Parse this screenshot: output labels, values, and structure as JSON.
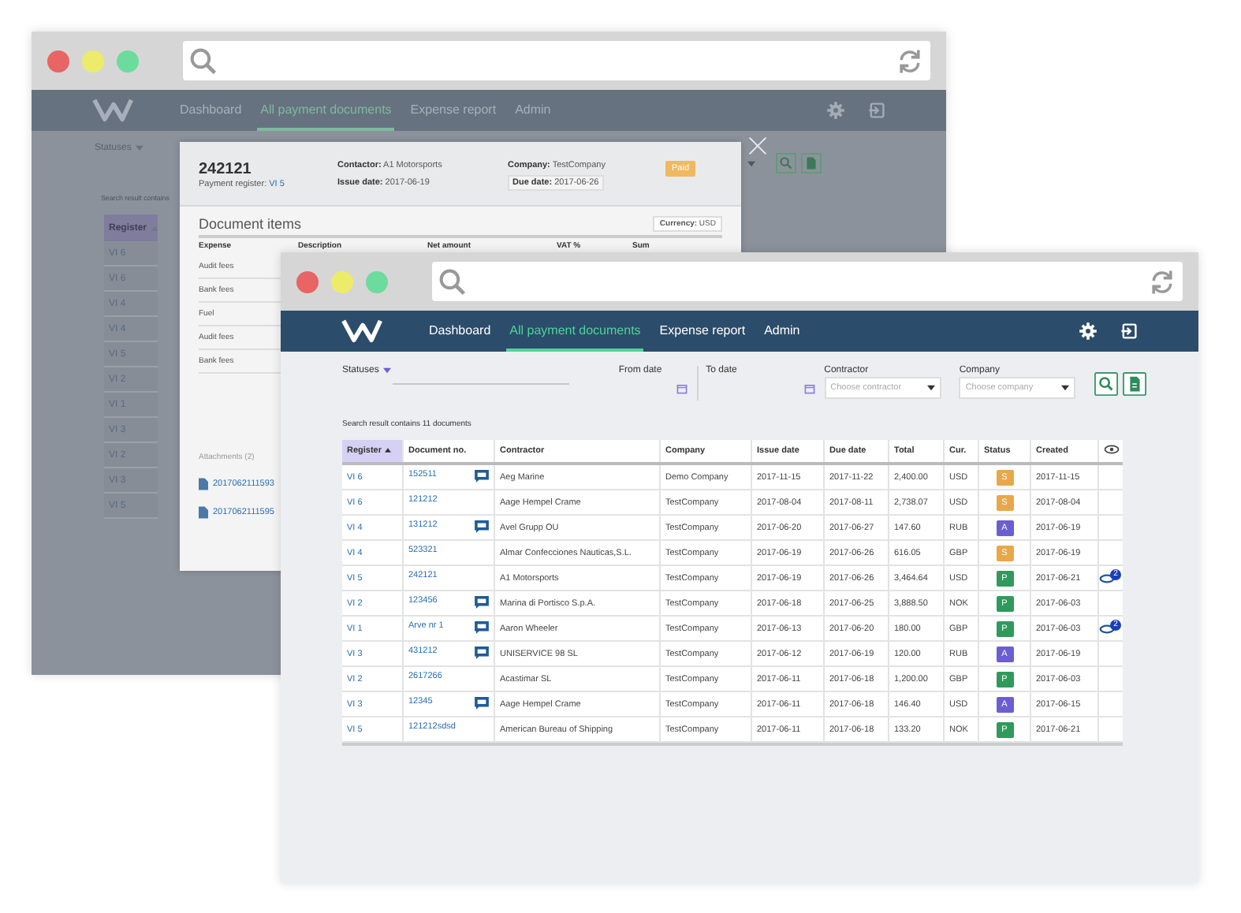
{
  "back_window": {
    "nav": [
      {
        "label": "Dashboard",
        "selected": false
      },
      {
        "label": "All payment documents",
        "selected": true
      },
      {
        "label": "Expense report",
        "selected": false
      },
      {
        "label": "Admin",
        "selected": false
      }
    ],
    "statuses_label": "Statuses",
    "result_text": "Search result contains",
    "table": {
      "column": "Register",
      "rows": [
        "VI 6",
        "VI 6",
        "VI 4",
        "VI 4",
        "VI 5",
        "VI 2",
        "VI 1",
        "VI 3",
        "VI 2",
        "VI 3",
        "VI 5"
      ]
    },
    "modal": {
      "number": "242121",
      "register_label": "Payment register:",
      "register": "VI 5",
      "fields": [
        {
          "label": "Contactor:",
          "value": "A1 Motorsports"
        },
        {
          "label": "Company:",
          "value": "TestCompany"
        },
        {
          "label": "Issue date:",
          "value": "2017-06-19"
        },
        {
          "label": "Due date:",
          "value": "2017-06-26"
        }
      ],
      "badge": "Paid",
      "items_title": "Document items",
      "currency_label": "Currency:",
      "currency": "USD",
      "columns": [
        "Expense",
        "Description",
        "Net amount",
        "VAT %",
        "Sum"
      ],
      "rows": [
        "Audit fees",
        "Bank fees",
        "Fuel",
        "Audit fees",
        "Bank fees"
      ],
      "attachments_label": "Attachments (2)",
      "attachments": [
        "2017062111593",
        "2017062111595"
      ]
    }
  },
  "front_window": {
    "nav": [
      {
        "label": "Dashboard",
        "selected": false
      },
      {
        "label": "All payment documents",
        "selected": true
      },
      {
        "label": "Expense report",
        "selected": false
      },
      {
        "label": "Admin",
        "selected": false
      }
    ],
    "filters": {
      "statuses_label": "Statuses",
      "from_label": "From date",
      "to_label": "To date",
      "contractor_label": "Contractor",
      "contractor_placeholder": "Choose contractor",
      "company_label": "Company",
      "company_placeholder": "Choose company"
    },
    "result_text": "Search result contains 11 documents",
    "table": {
      "columns": [
        "Register",
        "Document no.",
        "Contractor",
        "Company",
        "Issue date",
        "Due date",
        "Total",
        "Cur.",
        "Status",
        "Created"
      ],
      "rows": [
        {
          "register": "VI 6",
          "document_no": "152511",
          "comment": true,
          "contractor": "Aeg Marine",
          "company": "Demo Company",
          "issue_date": "2017-11-15",
          "due_date": "2017-11-22",
          "total": "2,400.00",
          "currency": "USD",
          "status": "S",
          "color": "#e8a84a",
          "created": "2017-11-15"
        },
        {
          "register": "VI 6",
          "document_no": "121212",
          "comment": false,
          "contractor": "Aage Hempel Crame",
          "company": "TestCompany",
          "issue_date": "2017-08-04",
          "due_date": "2017-08-11",
          "total": "2,738.07",
          "currency": "USD",
          "status": "S",
          "color": "#e8a84a",
          "created": "2017-08-04"
        },
        {
          "register": "VI 4",
          "document_no": "131212",
          "comment": true,
          "contractor": "Avel Grupp OU",
          "company": "TestCompany",
          "issue_date": "2017-06-20",
          "due_date": "2017-06-27",
          "total": "147.60",
          "currency": "RUB",
          "status": "A",
          "color": "#6b5ed3",
          "created": "2017-06-19"
        },
        {
          "register": "VI 4",
          "document_no": "523321",
          "comment": false,
          "contractor": "Almar Confecciones Nauticas,S.L.",
          "company": "TestCompany",
          "issue_date": "2017-06-19",
          "due_date": "2017-06-26",
          "total": "616.05",
          "currency": "GBP",
          "status": "S",
          "color": "#e8a84a",
          "created": "2017-06-19"
        },
        {
          "register": "VI 5",
          "document_no": "242121",
          "comment": false,
          "contractor": "A1 Motorsports",
          "company": "TestCompany",
          "issue_date": "2017-06-19",
          "due_date": "2017-06-26",
          "total": "3,464.64",
          "currency": "USD",
          "status": "P",
          "color": "#2f9a5c",
          "created": "2017-06-21",
          "attachments": "2"
        },
        {
          "register": "VI 2",
          "document_no": "123456",
          "comment": true,
          "contractor": "Marina di Portisco S.p.A.",
          "company": "TestCompany",
          "issue_date": "2017-06-18",
          "due_date": "2017-06-25",
          "total": "3,888.50",
          "currency": "NOK",
          "status": "P",
          "color": "#2f9a5c",
          "created": "2017-06-03"
        },
        {
          "register": "VI 1",
          "document_no": "Arve nr 1",
          "comment": true,
          "contractor": "Aaron Wheeler",
          "company": "TestCompany",
          "issue_date": "2017-06-13",
          "due_date": "2017-06-20",
          "total": "180.00",
          "currency": "GBP",
          "status": "P",
          "color": "#2f9a5c",
          "created": "2017-06-03",
          "attachments": "2"
        },
        {
          "register": "VI 3",
          "document_no": "431212",
          "comment": true,
          "contractor": "UNISERVICE 98 SL",
          "company": "TestCompany",
          "issue_date": "2017-06-12",
          "due_date": "2017-06-19",
          "total": "120.00",
          "currency": "RUB",
          "status": "A",
          "color": "#6b5ed3",
          "created": "2017-06-19"
        },
        {
          "register": "VI 2",
          "document_no": "2617266",
          "comment": false,
          "contractor": "Acastimar SL",
          "company": "TestCompany",
          "issue_date": "2017-06-11",
          "due_date": "2017-06-18",
          "total": "1,200.00",
          "currency": "GBP",
          "status": "P",
          "color": "#2f9a5c",
          "created": "2017-06-03"
        },
        {
          "register": "VI 3",
          "document_no": "12345",
          "comment": true,
          "contractor": "Aage Hempel Crame",
          "company": "TestCompany",
          "issue_date": "2017-06-11",
          "due_date": "2017-06-18",
          "total": "146.40",
          "currency": "USD",
          "status": "A",
          "color": "#6b5ed3",
          "created": "2017-06-15"
        },
        {
          "register": "VI 5",
          "document_no": "121212sdsd",
          "comment": false,
          "contractor": "American Bureau of Shipping",
          "company": "TestCompany",
          "issue_date": "2017-06-11",
          "due_date": "2017-06-18",
          "total": "133.20",
          "currency": "NOK",
          "status": "P",
          "color": "#2f9a5c",
          "created": "2017-06-21"
        }
      ]
    }
  }
}
